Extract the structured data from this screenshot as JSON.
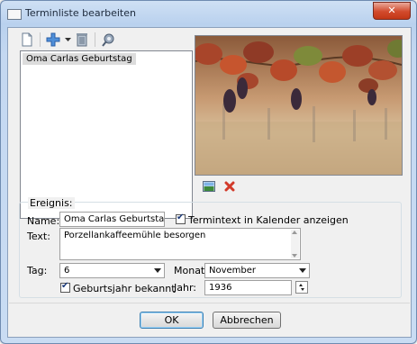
{
  "window": {
    "title": "Terminliste bearbeiten",
    "close_glyph": "✕"
  },
  "toolbar": {
    "icons": [
      "new-document-icon",
      "add-icon",
      "dropdown-arrow-icon",
      "delete-icon",
      "settings-icon"
    ]
  },
  "event_list": {
    "items": [
      {
        "label": "Oma Carlas Geburtstag",
        "selected": true
      }
    ]
  },
  "photo_tools": {
    "icons": [
      "change-image-icon",
      "remove-image-icon"
    ]
  },
  "event": {
    "group_label": "Ereignis:",
    "name_label": "Name:",
    "name_value": "Oma Carlas Geburtstag",
    "show_in_calendar_label": "Termintext in Kalender anzeigen",
    "show_in_calendar_checked": true,
    "text_label": "Text:",
    "text_value": "Porzellankaffeemühle besorgen",
    "day_label": "Tag:",
    "day_value": "6",
    "month_label": "Monat:",
    "month_value": "November",
    "birth_year_known_label": "Geburtsjahr bekannt",
    "birth_year_known_checked": true,
    "year_label": "Jahr:",
    "year_value": "1936"
  },
  "buttons": {
    "ok": "OK",
    "cancel": "Abbrechen"
  },
  "colors": {
    "title_bar": "#c4d8f1",
    "close_button": "#c23716",
    "selection": "#dcdcdc",
    "focus_border": "#3c7fb1"
  }
}
